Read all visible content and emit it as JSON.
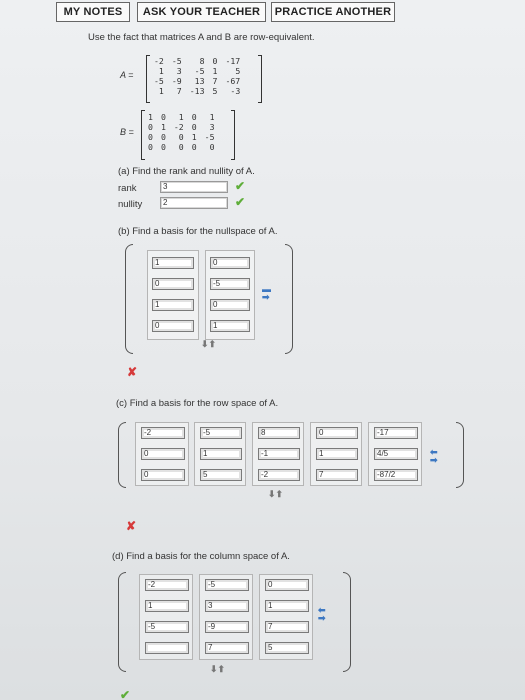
{
  "toolbar": {
    "my_notes": "MY NOTES",
    "ask_teacher": "ASK YOUR TEACHER",
    "practice": "PRACTICE ANOTHER"
  },
  "prompt": "Use the fact that matrices A and B are row-equivalent.",
  "matrixA": {
    "label": "A =",
    "rows": [
      [
        "-2",
        "-5",
        "8",
        "0",
        "-17"
      ],
      [
        "1",
        "3",
        "-5",
        "1",
        "5"
      ],
      [
        "-5",
        "-9",
        "13",
        "7",
        "-67"
      ],
      [
        "1",
        "7",
        "-13",
        "5",
        "-3"
      ]
    ]
  },
  "matrixB": {
    "label": "B =",
    "rows": [
      [
        "1",
        "0",
        "1",
        "0",
        "1"
      ],
      [
        "0",
        "1",
        "-2",
        "0",
        "3"
      ],
      [
        "0",
        "0",
        "0",
        "1",
        "-5"
      ],
      [
        "0",
        "0",
        "0",
        "0",
        "0"
      ]
    ]
  },
  "partA": {
    "question": "(a) Find the rank and nullity of A.",
    "rank_label": "rank",
    "rank_value": "3",
    "nullity_label": "nullity",
    "nullity_value": "2"
  },
  "partB": {
    "question": "(b) Find a basis for the nullspace of A.",
    "vectors": [
      [
        "1",
        "0",
        "1",
        "0"
      ],
      [
        "0",
        "-5",
        "0",
        "1"
      ]
    ]
  },
  "partC": {
    "question": "(c) Find a basis for the row space of A.",
    "vectors": [
      [
        "-2",
        "0",
        "0"
      ],
      [
        "-5",
        "1",
        "5"
      ],
      [
        "8",
        "-1",
        "-2"
      ],
      [
        "0",
        "1",
        "7"
      ],
      [
        "-17",
        "4/5",
        "-87/2"
      ]
    ]
  },
  "partD": {
    "question": "(d) Find a basis for the column space of A.",
    "vectors": [
      [
        "-2",
        "1",
        "-5",
        ""
      ],
      [
        "-5",
        "3",
        "-9",
        "7"
      ],
      [
        "0",
        "1",
        "7",
        "5"
      ]
    ]
  },
  "colors": {
    "check": "#5fae3a",
    "cross": "#d63a3a",
    "control": "#3d78c2"
  }
}
